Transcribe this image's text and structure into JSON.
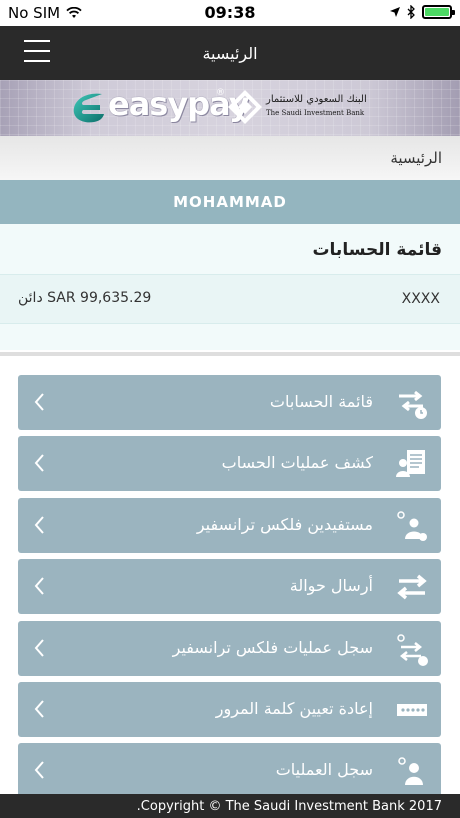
{
  "status": {
    "carrier": "No SIM",
    "time": "09:38"
  },
  "nav": {
    "title": "الرئيسية"
  },
  "brand": {
    "product": "easypay",
    "reg": "®",
    "bank_ar": "البنك السعودي للاستثمار",
    "bank_en": "The Saudi Investment Bank"
  },
  "breadcrumb": "الرئيسية",
  "user": {
    "name": "MOHAMMAD"
  },
  "accounts": {
    "title": "قائمة الحسابات",
    "items": [
      {
        "number": "XXXX",
        "balance": "SAR 99,635.29 دائن"
      }
    ]
  },
  "menu": [
    {
      "label": "قائمة الحسابات",
      "icon": "transfer-clock-icon"
    },
    {
      "label": "كشف عمليات الحساب",
      "icon": "statement-icon"
    },
    {
      "label": "مستفيدين فلكس ترانسفير",
      "icon": "beneficiaries-icon"
    },
    {
      "label": "أرسال حوالة",
      "icon": "swap-arrows-icon"
    },
    {
      "label": "سجل عمليات فلكس ترانسفير",
      "icon": "transfer-history-icon"
    },
    {
      "label": "إعادة تعيين كلمة المرور",
      "icon": "password-icon"
    },
    {
      "label": "سجل العمليات",
      "icon": "user-gear-icon"
    }
  ],
  "footer": {
    "copyright": ".Copyright © The Saudi Investment Bank 2017"
  },
  "colors": {
    "menu_bg": "#9bb4bf",
    "user_bar": "#94b5bf",
    "nav_bg": "#2a2a2a",
    "battery": "#4cd964"
  }
}
